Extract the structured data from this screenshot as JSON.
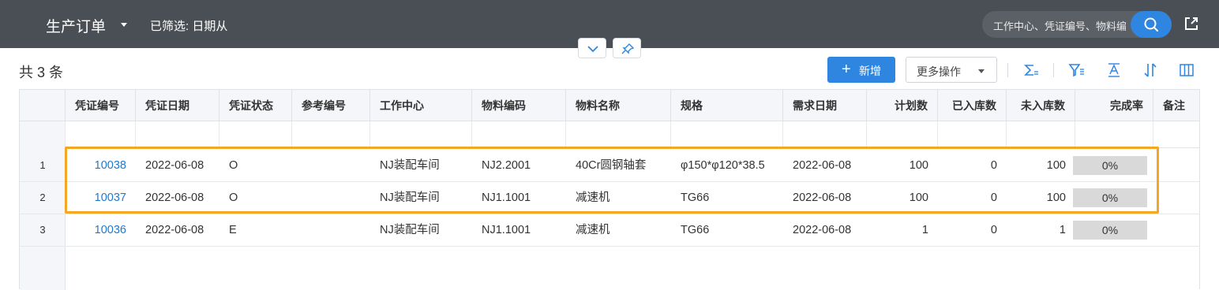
{
  "header": {
    "title": "生产订单",
    "filter_text": "已筛选: 日期从",
    "search_placeholder": "工作中心、凭证编号、物料编码"
  },
  "toolbar": {
    "count_text": "共 3 条",
    "add_label": "新增",
    "more_label": "更多操作"
  },
  "table": {
    "columns": [
      "凭证编号",
      "凭证日期",
      "凭证状态",
      "参考编号",
      "工作中心",
      "物料编码",
      "物料名称",
      "规格",
      "需求日期",
      "计划数",
      "已入库数",
      "未入库数",
      "完成率",
      "备注"
    ],
    "rows": [
      {
        "no": "1",
        "voucher": "10038",
        "date": "2022-06-08",
        "status": "O",
        "ref": "",
        "center": "NJ装配车间",
        "code": "NJ2.2001",
        "name": "40Cr圆钢轴套",
        "spec": "φ150*φ120*38.5",
        "due": "2022-06-08",
        "plan": "100",
        "in": "0",
        "notin": "100",
        "rate": "0%",
        "note": ""
      },
      {
        "no": "2",
        "voucher": "10037",
        "date": "2022-06-08",
        "status": "O",
        "ref": "",
        "center": "NJ装配车间",
        "code": "NJ1.1001",
        "name": "减速机",
        "spec": "TG66",
        "due": "2022-06-08",
        "plan": "100",
        "in": "0",
        "notin": "100",
        "rate": "0%",
        "note": ""
      },
      {
        "no": "3",
        "voucher": "10036",
        "date": "2022-06-08",
        "status": "E",
        "ref": "",
        "center": "NJ装配车间",
        "code": "NJ1.1001",
        "name": "减速机",
        "spec": "TG66",
        "due": "2022-06-08",
        "plan": "1",
        "in": "0",
        "notin": "1",
        "rate": "0%",
        "note": ""
      }
    ]
  },
  "colors": {
    "topbar": "#4a4f55",
    "accent": "#2f86e0",
    "link": "#1f78d1",
    "highlight": "#f5a623"
  }
}
